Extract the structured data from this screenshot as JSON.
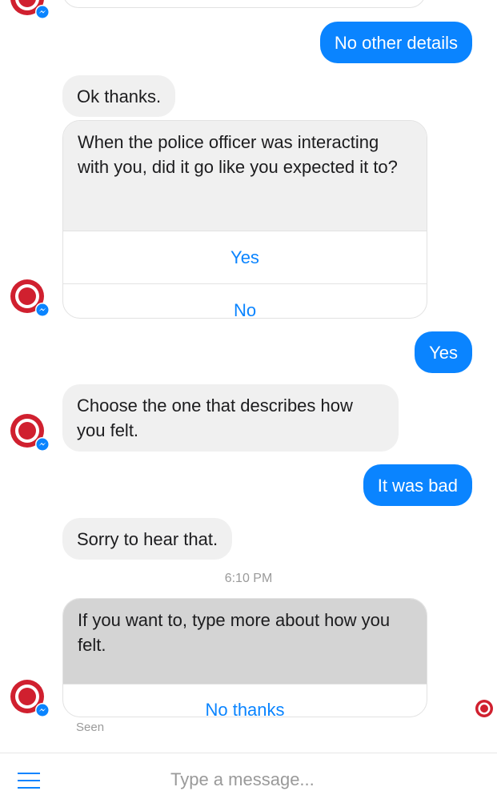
{
  "messages": {
    "m1": "No other details",
    "m2": "Ok thanks.",
    "card1": {
      "text": "When the police officer was interacting with you, did it go like you expected it to?",
      "options": [
        "Yes",
        "No"
      ]
    },
    "m3": "Yes",
    "m4": "Choose the one that describes how you felt.",
    "m5": "It was bad",
    "m6": "Sorry to hear that.",
    "timestamp": "6:10 PM",
    "card2": {
      "text": "If you want to, type more about how you felt.",
      "options": [
        "No thanks"
      ]
    },
    "seen": "Seen"
  },
  "composer": {
    "placeholder": "Type a message...",
    "menu_icon": "hamburger-menu-icon"
  },
  "colors": {
    "outgoing": "#0a84ff",
    "incoming": "#f0f0f0",
    "brand": "#d0202f",
    "messenger_badge": "#0a84ff"
  },
  "icons": {
    "avatar": "bot-avatar-icon",
    "badge": "messenger-badge-icon",
    "read_receipt": "read-receipt-icon"
  }
}
